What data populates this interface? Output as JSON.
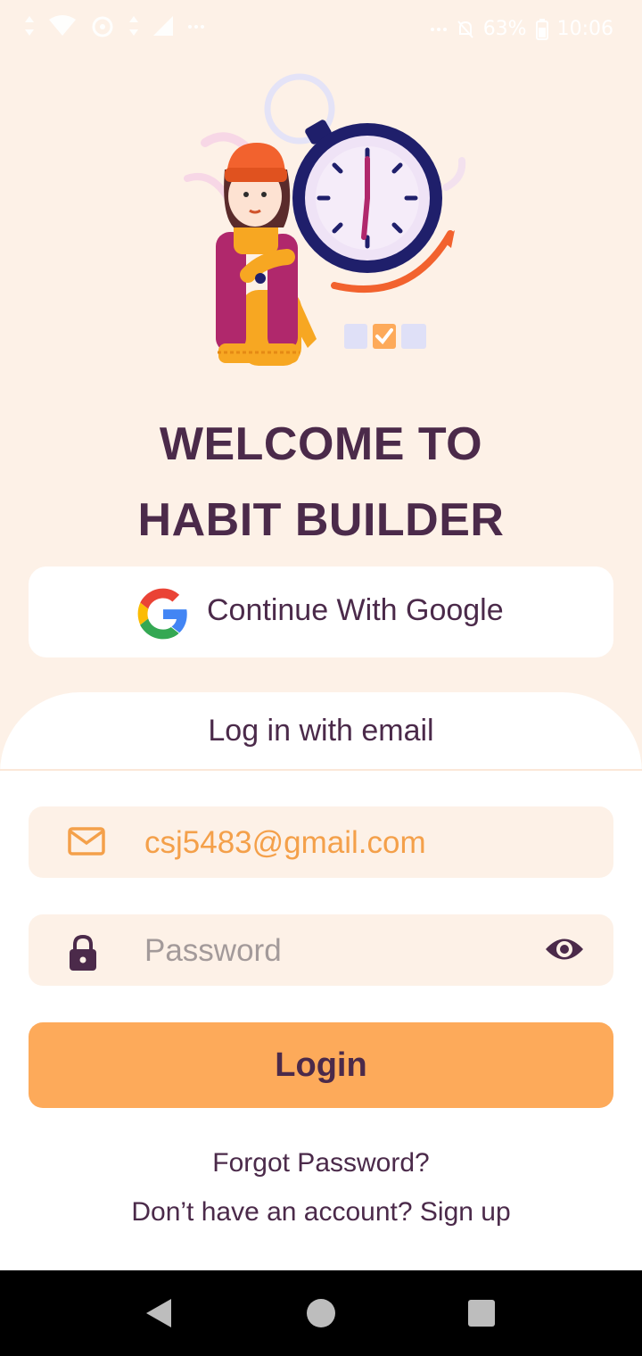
{
  "status_bar": {
    "battery": "63%",
    "time": "10:06"
  },
  "welcome": {
    "line1": "WELCOME TO",
    "line2": "HABIT BUILDER"
  },
  "google": {
    "label": "Continue With Google"
  },
  "login_section": {
    "title": "Log in with email",
    "email_value": "csj5483@gmail.com",
    "password_placeholder": "Password",
    "login_label": "Login",
    "forgot_label": "Forgot Password?",
    "signup_label": "Don’t have an account? Sign up"
  },
  "colors": {
    "background": "#fdf1e7",
    "primary_text": "#4b2a4a",
    "accent": "#fdaa5a",
    "email_text": "#f4a04a"
  },
  "icons": {
    "email": "mail-icon",
    "password": "lock-icon",
    "visibility": "eye-icon",
    "google": "google-logo-icon"
  }
}
